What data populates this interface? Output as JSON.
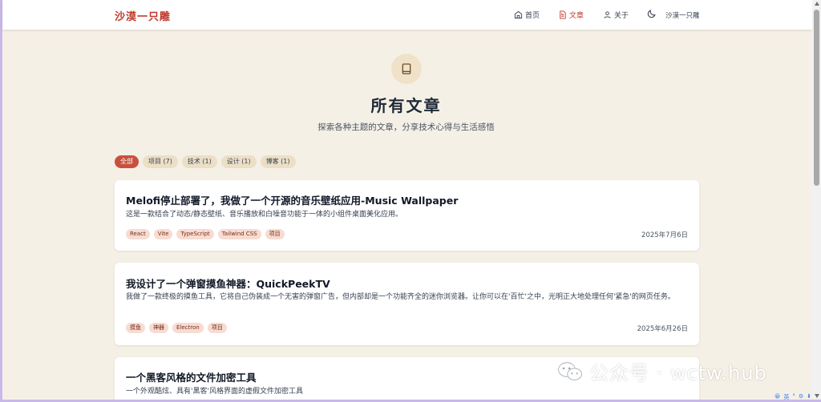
{
  "header": {
    "logo": "沙漠一只雕",
    "nav": [
      {
        "label": "首页",
        "icon": "home-icon"
      },
      {
        "label": "文章",
        "icon": "file-text-icon"
      },
      {
        "label": "关于",
        "icon": "user-icon"
      }
    ],
    "theme_icon": "moon-icon",
    "user": "沙漠一只雕"
  },
  "hero": {
    "icon": "book-icon",
    "title": "所有文章",
    "subtitle": "探索各种主题的文章，分享技术心得与生活感悟"
  },
  "filters": [
    "全部",
    "项目 (7)",
    "技术 (1)",
    "设计 (1)",
    "博客 (1)"
  ],
  "articles": [
    {
      "title": "Melofi停止部署了，我做了一个开源的音乐壁纸应用-Music Wallpaper",
      "desc": "这是一款结合了动态/静态壁纸、音乐播放和白噪音功能于一体的小组件桌面美化应用。",
      "tags": [
        "React",
        "Vite",
        "TypeScript",
        "Tailwind CSS",
        "项目"
      ],
      "date": "2025年7月6日"
    },
    {
      "title": "我设计了一个弹窗摸鱼神器：QuickPeekTV",
      "desc": "我做了一款终极的摸鱼工具，它将自己伪装成一个无害的弹窗广告，但内部却是一个功能齐全的迷你浏览器。让你可以在'百忙'之中，光明正大地处理任何'紧急'的网页任务。",
      "tags": [
        "摸鱼",
        "神器",
        "Electron",
        "项目"
      ],
      "date": "2025年6月26日"
    },
    {
      "title": "一个黑客风格的文件加密工具",
      "desc": "一个外观酷炫、具有'黑客'风格界面的虚假文件加密工具"
    }
  ],
  "watermark": {
    "text": "公众号 · wctw.hub"
  },
  "tray": [
    "😀",
    "英",
    "°",
    "⚙",
    "⬇"
  ]
}
